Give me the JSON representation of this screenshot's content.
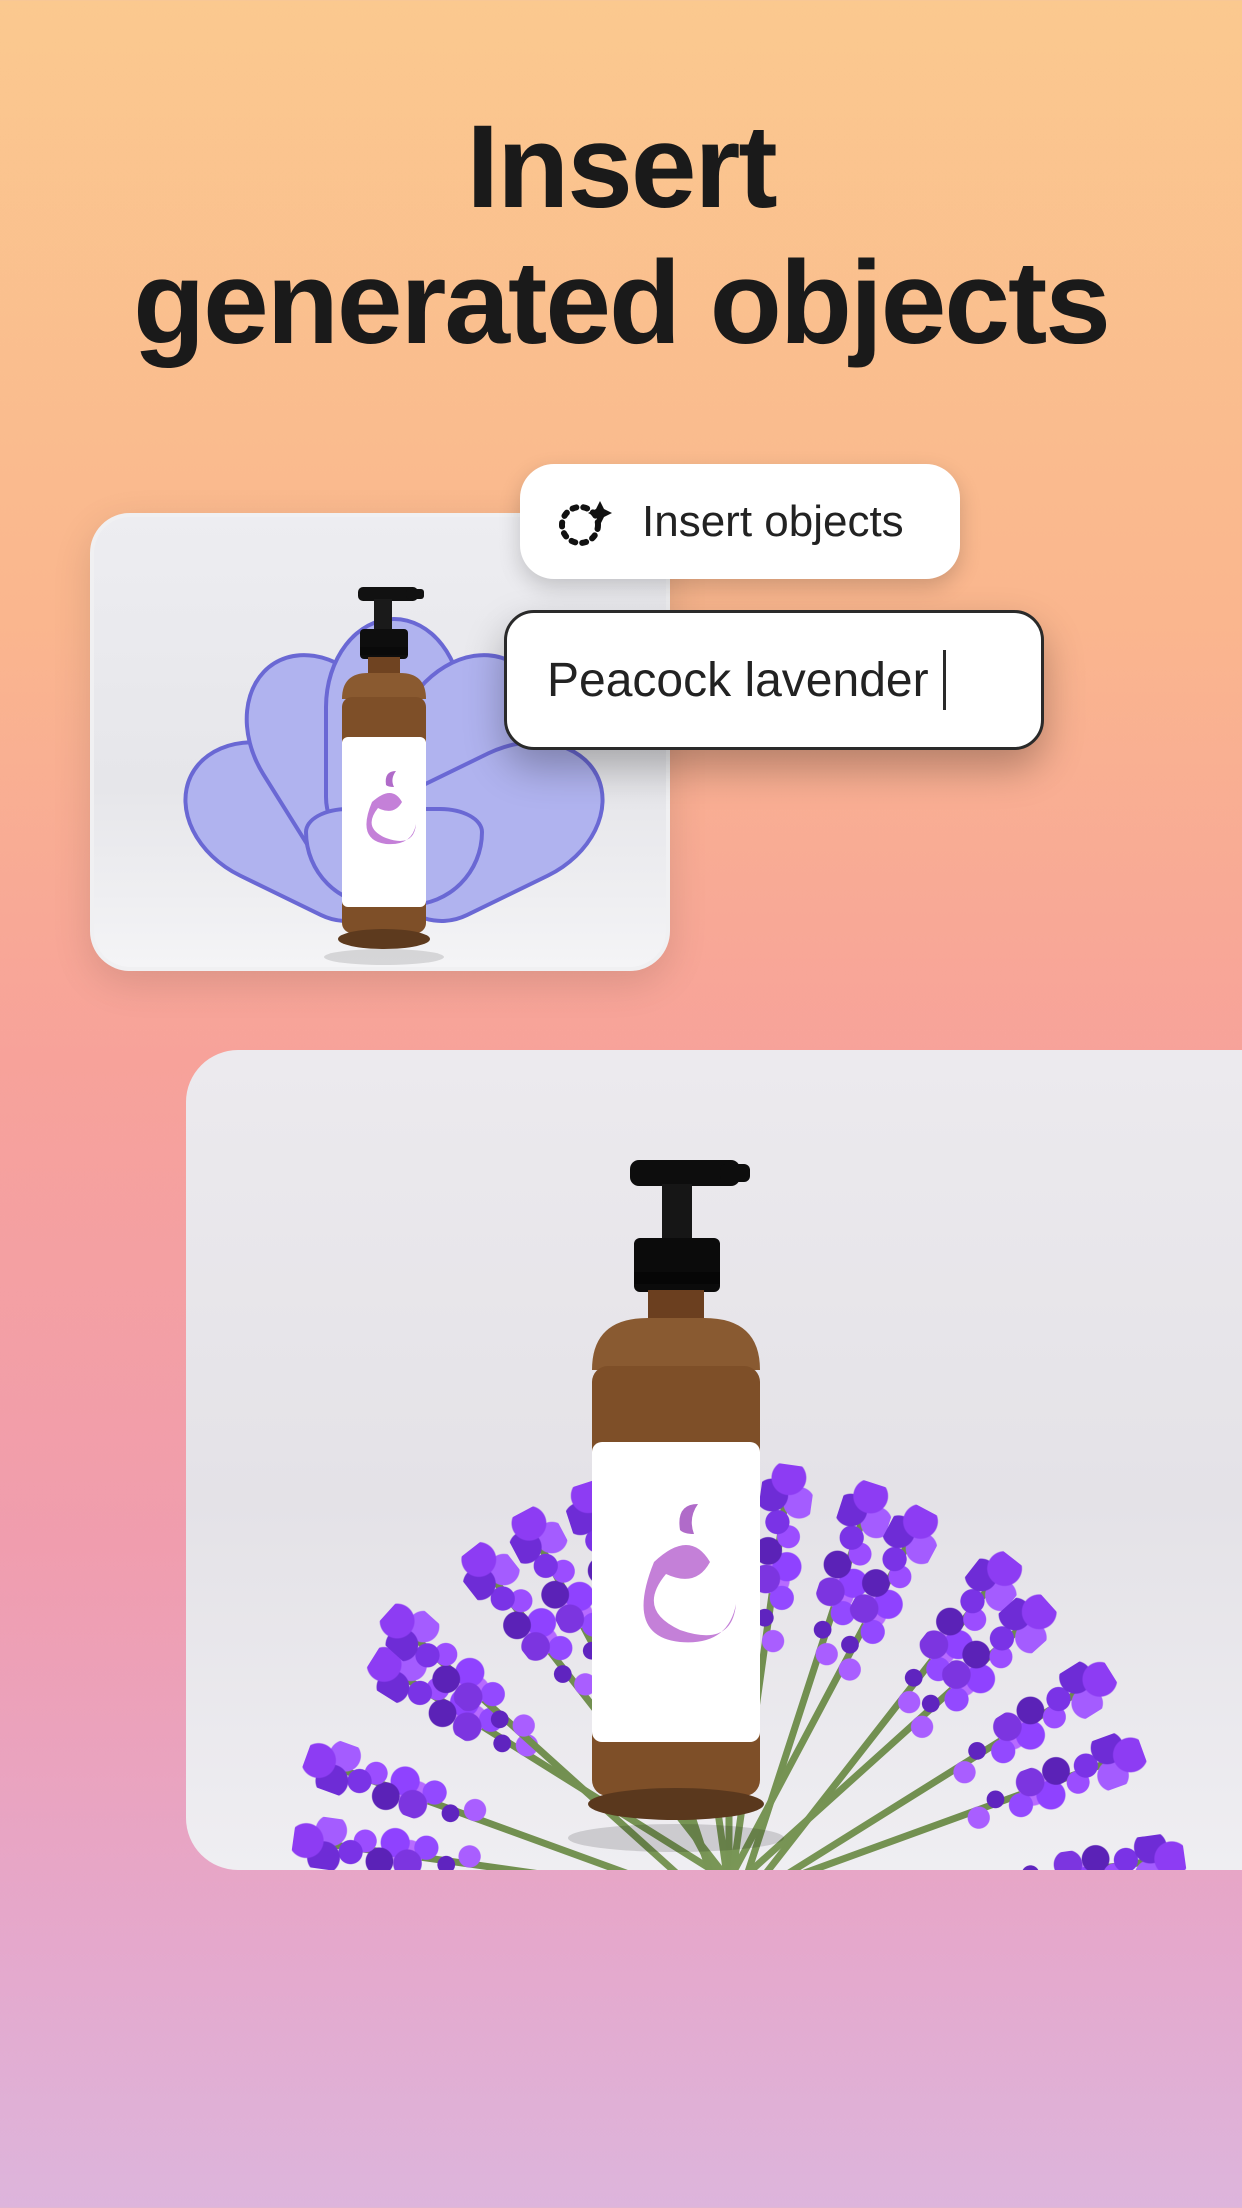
{
  "headline": {
    "line1": "Insert",
    "line2": "generated objects"
  },
  "action_button": {
    "label": "Insert objects"
  },
  "prompt_input": {
    "value": "Peacock lavender"
  }
}
